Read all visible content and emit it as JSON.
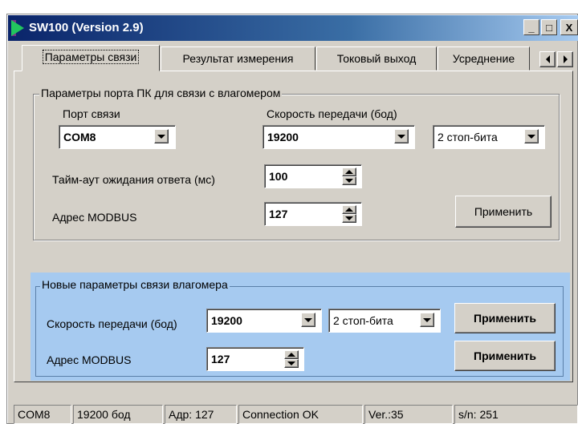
{
  "window": {
    "title": "SW100 (Version 2.9)",
    "minimize": "_",
    "maximize": "□",
    "close": "X"
  },
  "tabs": [
    {
      "label": "Параметры связи"
    },
    {
      "label": "Результат измерения"
    },
    {
      "label": "Токовый выход"
    },
    {
      "label": "Усреднение"
    }
  ],
  "pc_port": {
    "legend": "Параметры порта ПК для связи с влагомером",
    "port_label": "Порт связи",
    "port_value": "COM8",
    "speed_label": "Скорость передачи (бод)",
    "speed_value": "19200",
    "stopbits_value": "2 стоп-бита",
    "timeout_label": "Тайм-аут ожидания ответа (мс)",
    "timeout_value": "100",
    "address_label": "Адрес MODBUS",
    "address_value": "127",
    "apply_label": "Применить"
  },
  "new_params": {
    "legend": "Новые параметры связи влагомера",
    "speed_label": "Скорость передачи (бод)",
    "speed_value": "19200",
    "stopbits_value": "2 стоп-бита",
    "apply_speed_label": "Применить",
    "address_label": "Адрес MODBUS",
    "address_value": "127",
    "apply_address_label": "Применить",
    "background": "#a6caf0"
  },
  "status_bar": {
    "port": "COM8",
    "speed": "19200 бод",
    "address": "Адр: 127",
    "connection": "Connection OK",
    "version": "Ver.:35",
    "serial": "s/n: 251"
  }
}
